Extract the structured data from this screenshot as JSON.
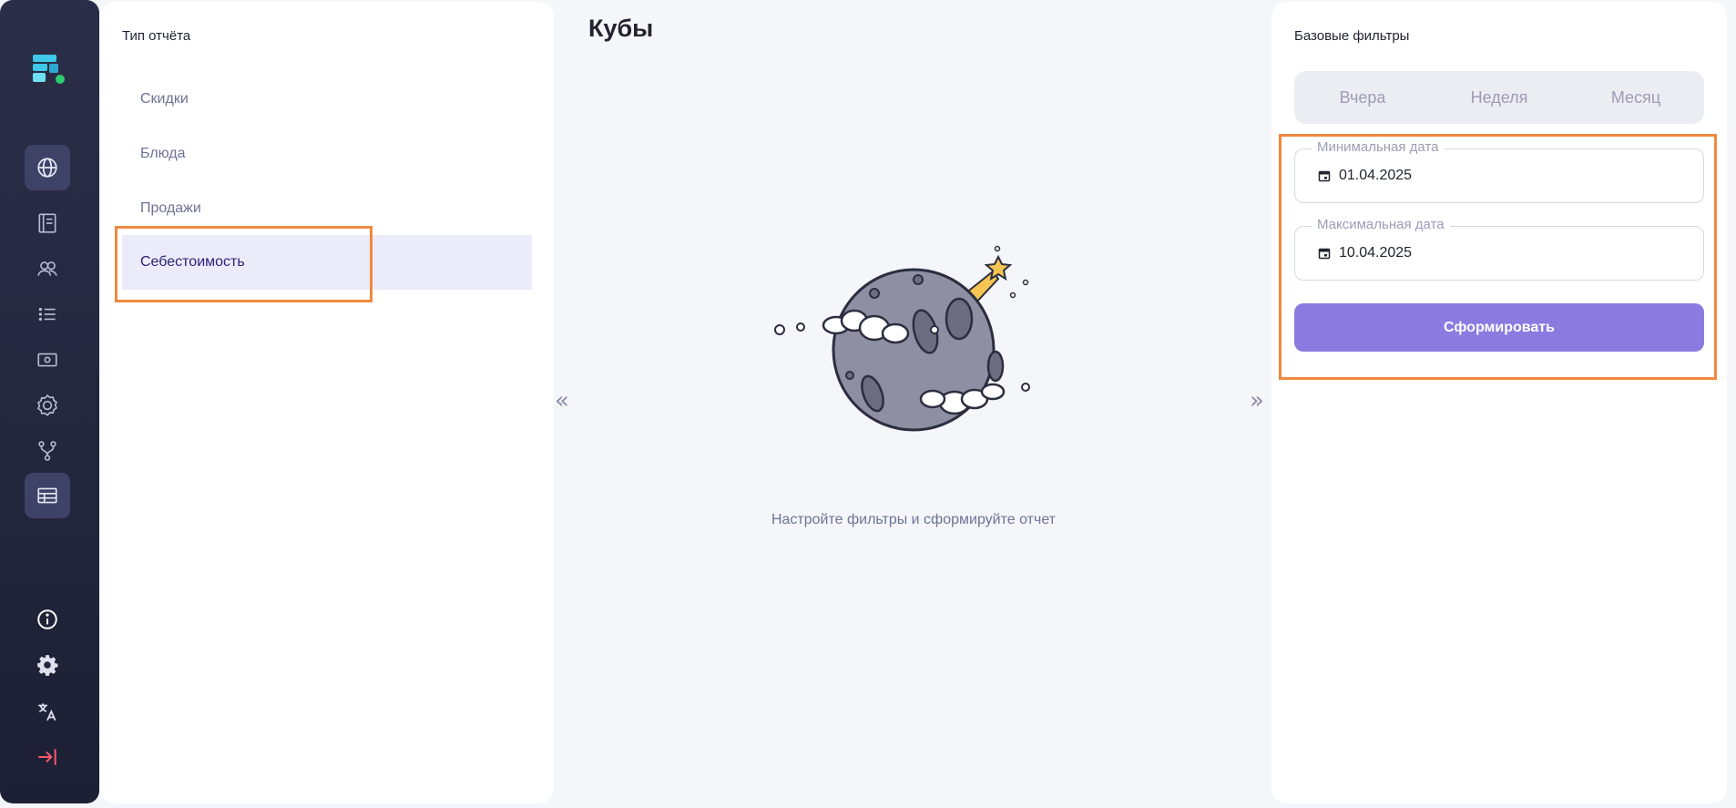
{
  "sidebar": {
    "items": [
      {
        "icon": "globe-icon",
        "active": true
      },
      {
        "icon": "book-icon",
        "active": false
      },
      {
        "icon": "users-icon",
        "active": false
      },
      {
        "icon": "list-icon",
        "active": false
      },
      {
        "icon": "cash-icon",
        "active": false
      },
      {
        "icon": "badge-icon",
        "active": false
      },
      {
        "icon": "branch-icon",
        "active": false
      },
      {
        "icon": "table-icon",
        "active": true
      }
    ],
    "bottom_items": [
      "info-icon",
      "gear-icon",
      "translate-icon",
      "logout-icon"
    ]
  },
  "report_type": {
    "title": "Тип отчёта",
    "items": [
      "Скидки",
      "Блюда",
      "Продажи",
      "Себестоимость"
    ],
    "selected_index": 3
  },
  "main": {
    "title": "Кубы",
    "empty_message": "Настройте фильтры и сформируйте отчет",
    "collapse_left": "«",
    "collapse_right": "»"
  },
  "filters": {
    "title": "Базовые фильтры",
    "periods": [
      "Вчера",
      "Неделя",
      "Месяц"
    ],
    "min_date": {
      "label": "Минимальная дата",
      "value": "01.04.2025"
    },
    "max_date": {
      "label": "Максимальная дата",
      "value": "10.04.2025"
    },
    "submit_label": "Сформировать"
  },
  "colors": {
    "accent": "#8b7ae0",
    "highlight": "#f08940",
    "rail": "#23263c"
  }
}
